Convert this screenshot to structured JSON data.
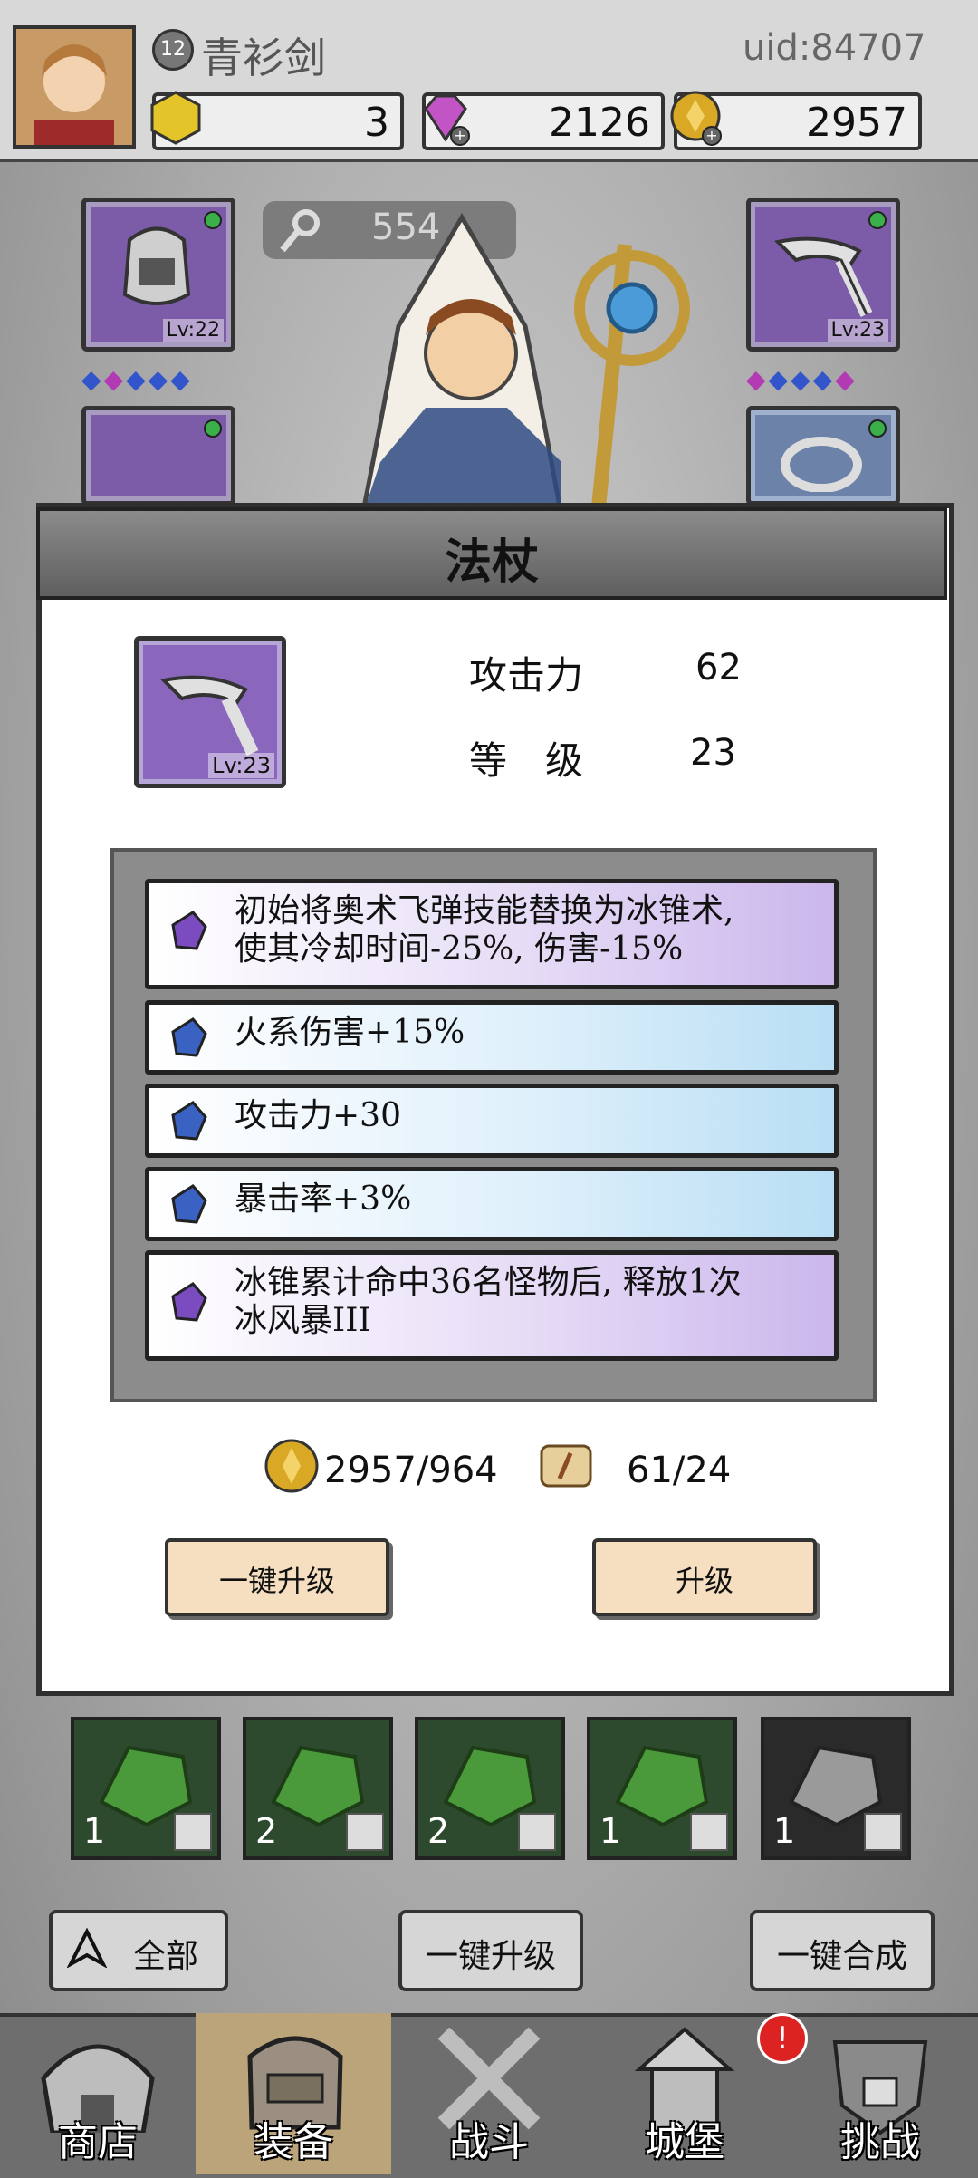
{
  "player": {
    "level": "12",
    "name": "青衫剑",
    "uid": "uid:84707"
  },
  "resources": {
    "energy": "3",
    "gems": "2126",
    "coins": "2957"
  },
  "hero": {
    "power": "554"
  },
  "equipment": {
    "top_left_level": "Lv:22",
    "top_right_level": "Lv:23"
  },
  "modal": {
    "title": "法杖",
    "item_level": "Lv:23",
    "stats": [
      {
        "label": "攻击力",
        "value": "62"
      },
      {
        "label": "等　级",
        "value": "23"
      }
    ],
    "affixes": [
      {
        "text": "初始将奥术飞弹技能替换为冰锥术,\n使其冷却时间-25%, 伤害-15%",
        "color": "purple"
      },
      {
        "text": "火系伤害+15%",
        "color": "blue"
      },
      {
        "text": "攻击力+30",
        "color": "blue"
      },
      {
        "text": "暴击率+3%",
        "color": "blue"
      },
      {
        "text": "冰锥累计命中36名怪物后, 释放1次\n冰风暴III",
        "color": "purple"
      }
    ],
    "cost_coins": "2957/964",
    "cost_scrolls": "61/24",
    "btn_upgrade_all": "一键升级",
    "btn_upgrade": "升级"
  },
  "materials": [
    {
      "count": "1"
    },
    {
      "count": "2"
    },
    {
      "count": "2"
    },
    {
      "count": "1"
    },
    {
      "count": "1"
    }
  ],
  "actions": {
    "filter": "全部",
    "upgrade_all": "一键升级",
    "merge_all": "一键合成"
  },
  "nav": {
    "shop": "商店",
    "equip": "装备",
    "battle": "战斗",
    "castle": "城堡",
    "challenge": "挑战",
    "alert": "!"
  }
}
